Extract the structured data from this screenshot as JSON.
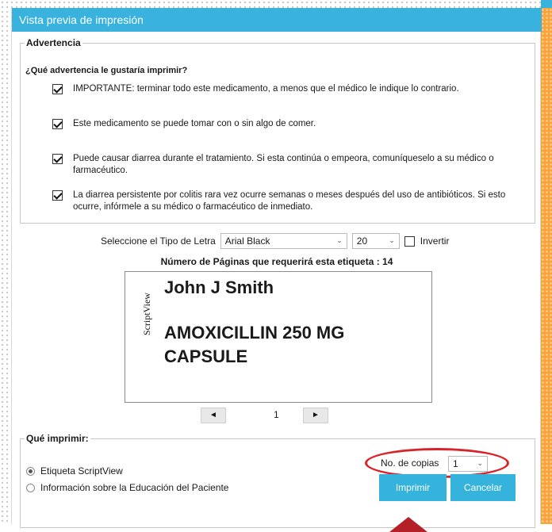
{
  "window": {
    "title": "Vista previa de impresión"
  },
  "warnings": {
    "legend": "Advertencia",
    "question": "¿Qué advertencia le gustaría imprimir?",
    "items": [
      {
        "checked": true,
        "text": "IMPORTANTE: terminar todo este medicamento, a menos que el médico le indique lo contrario."
      },
      {
        "checked": true,
        "text": "Este medicamento se puede tomar con o sin algo de comer."
      },
      {
        "checked": true,
        "text": "Puede causar diarrea durante el tratamiento. Si esta continúa o empeora, comuníqueselo a su médico o farmacéutico."
      },
      {
        "checked": true,
        "text": "La diarrea persistente por colitis rara vez ocurre semanas o meses después del uso de antibióticos. Si esto ocurre, infórmele a su médico o farmacéutico de inmediato."
      }
    ]
  },
  "font_settings": {
    "label": "Seleccione el Tipo de Letra",
    "font": "Arial Black",
    "size": "20",
    "invert_label": "Invertir",
    "invert_checked": false
  },
  "pages_note": "Número de Páginas que requerirá esta etiqueta : 14",
  "preview": {
    "brand": "ScriptView",
    "patient_name": "John J Smith",
    "drug_line1": "AMOXICILLIN 250 MG",
    "drug_line2": "CAPSULE"
  },
  "pager": {
    "prev": "◄",
    "page": "1",
    "next": "►"
  },
  "print_options": {
    "legend": "Qué imprimir:",
    "options": [
      {
        "label": "Etiqueta ScriptView",
        "selected": true
      },
      {
        "label": "Información sobre la Educación del Paciente",
        "selected": false
      }
    ],
    "copies_label": "No. de copias",
    "copies_value": "1"
  },
  "buttons": {
    "print": "Imprimir",
    "cancel": "Cancelar"
  },
  "colors": {
    "title_bar": "#39b3dd",
    "button": "#35b3dc",
    "highlight": "#d8232a",
    "side_strip": "#f7a43a"
  }
}
